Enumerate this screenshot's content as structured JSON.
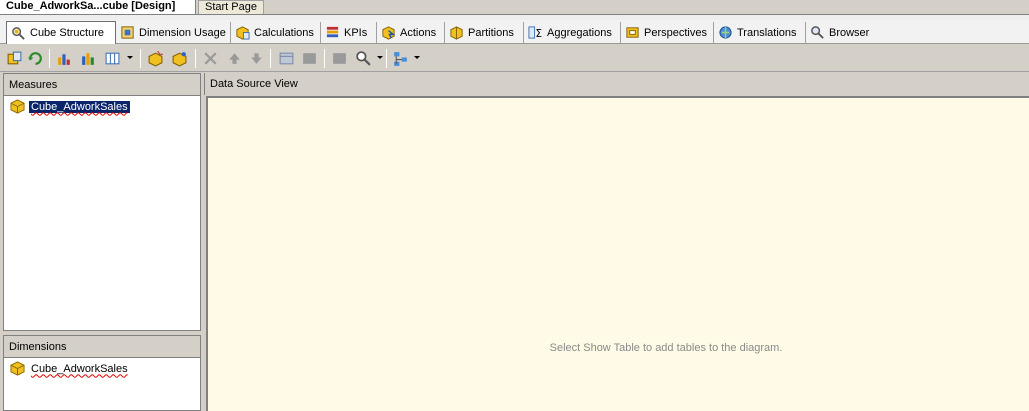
{
  "document_tabs": [
    {
      "label": "Cube_AdworkSa...cube [Design]",
      "active": true
    },
    {
      "label": "Start Page",
      "active": false
    }
  ],
  "designer_tabs": [
    {
      "label": "Cube Structure",
      "icon": "cube-structure-icon",
      "active": true
    },
    {
      "label": "Dimension Usage",
      "icon": "dimension-usage-icon"
    },
    {
      "label": "Calculations",
      "icon": "calculations-icon"
    },
    {
      "label": "KPIs",
      "icon": "kpis-icon"
    },
    {
      "label": "Actions",
      "icon": "actions-icon"
    },
    {
      "label": "Partitions",
      "icon": "partitions-icon"
    },
    {
      "label": "Aggregations",
      "icon": "aggregations-icon"
    },
    {
      "label": "Perspectives",
      "icon": "perspectives-icon"
    },
    {
      "label": "Translations",
      "icon": "translations-icon"
    },
    {
      "label": "Browser",
      "icon": "browser-icon"
    }
  ],
  "measures": {
    "header": "Measures",
    "items": [
      {
        "label": "Cube_AdworkSales",
        "selected": true
      }
    ]
  },
  "dimensions": {
    "header": "Dimensions",
    "items": [
      {
        "label": "Cube_AdworkSales"
      }
    ]
  },
  "dsv": {
    "header": "Data Source View",
    "empty_message": "Select Show Table to add tables to the diagram."
  },
  "colors": {
    "selection": "#0a246a",
    "dsv_background": "#fffbe6",
    "chrome": "#d4d0c8"
  }
}
